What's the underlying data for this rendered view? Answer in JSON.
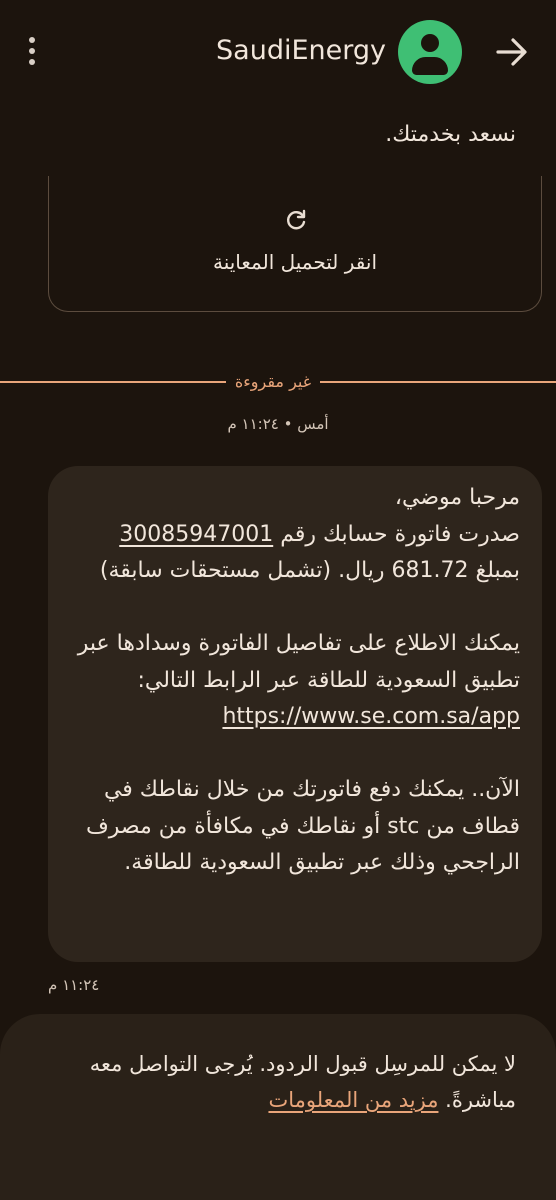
{
  "header": {
    "title": "SaudiEnergy",
    "menu_icon": "more-vert-icon",
    "avatar_icon": "person-icon",
    "forward_icon": "arrow-forward-icon",
    "accent_color": "#3fbf74"
  },
  "previous_message": {
    "text": "نسعد بخدمتك.",
    "preview_action_label": "انقر لتحميل المعاينة",
    "preview_action_icon": "reload-icon"
  },
  "unread_divider": {
    "label": "غير مقروءة",
    "color": "#e9a57a"
  },
  "message_header_timestamp": "أمس • ١١:٢٤ م",
  "message": {
    "line1": "مرحبا موضي،",
    "line2_prefix": "صدرت فاتورة حسابك رقم ",
    "account_number": "30085947001",
    "line3": "بمبلغ 681.72 ريال. (تشمل مستحقات سابقة)",
    "paragraph2": "يمكنك الاطلاع على تفاصيل الفاتورة وسدادها عبر تطبيق السعودية للطاقة عبر الرابط التالي:",
    "link": "https://www.se.com.sa/app",
    "paragraph3": "الآن.. يمكنك دفع فاتورتك من خلال نقاطك في قطاف من stc أو نقاطك في مكافأة من مصرف الراجحي وذلك عبر تطبيق السعودية للطاقة."
  },
  "message_timestamp": "١١:٢٤ م",
  "notice": {
    "text": "لا يمكن للمرسِل قبول الردود. يُرجى التواصل معه مباشرةً. ",
    "link_label": "مزيد من المعلومات"
  }
}
